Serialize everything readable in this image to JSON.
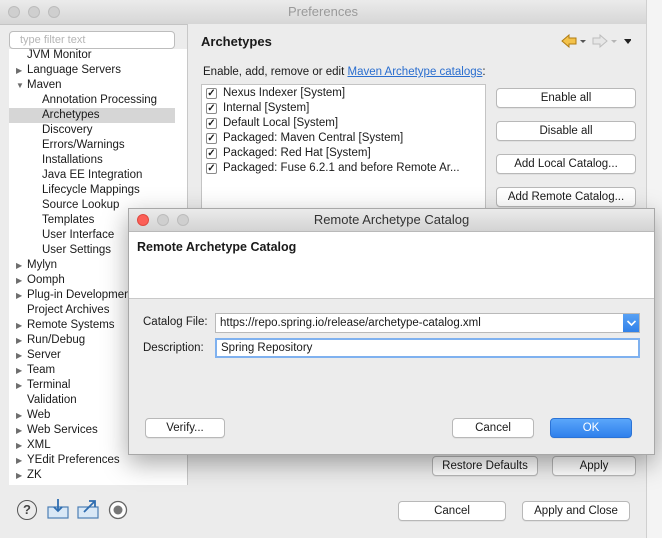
{
  "window": {
    "title": "Preferences"
  },
  "filter": {
    "placeholder": "type filter text"
  },
  "tree": [
    {
      "label": "JVM Monitor",
      "arrow": "",
      "indent": 1,
      "selected": false
    },
    {
      "label": "Language Servers",
      "arrow": "▶",
      "indent": 0,
      "selected": false
    },
    {
      "label": "Maven",
      "arrow": "▼",
      "indent": 0,
      "selected": false
    },
    {
      "label": "Annotation Processing",
      "arrow": "",
      "indent": 2,
      "selected": false
    },
    {
      "label": "Archetypes",
      "arrow": "",
      "indent": 2,
      "selected": true
    },
    {
      "label": "Discovery",
      "arrow": "",
      "indent": 2,
      "selected": false
    },
    {
      "label": "Errors/Warnings",
      "arrow": "",
      "indent": 2,
      "selected": false
    },
    {
      "label": "Installations",
      "arrow": "",
      "indent": 2,
      "selected": false
    },
    {
      "label": "Java EE Integration",
      "arrow": "",
      "indent": 2,
      "selected": false
    },
    {
      "label": "Lifecycle Mappings",
      "arrow": "",
      "indent": 2,
      "selected": false
    },
    {
      "label": "Source Lookup",
      "arrow": "",
      "indent": 2,
      "selected": false
    },
    {
      "label": "Templates",
      "arrow": "",
      "indent": 2,
      "selected": false
    },
    {
      "label": "User Interface",
      "arrow": "",
      "indent": 2,
      "selected": false
    },
    {
      "label": "User Settings",
      "arrow": "",
      "indent": 2,
      "selected": false
    },
    {
      "label": "Mylyn",
      "arrow": "▶",
      "indent": 0,
      "selected": false
    },
    {
      "label": "Oomph",
      "arrow": "▶",
      "indent": 0,
      "selected": false
    },
    {
      "label": "Plug-in Development",
      "arrow": "▶",
      "indent": 0,
      "selected": false
    },
    {
      "label": "Project Archives",
      "arrow": "",
      "indent": 1,
      "selected": false
    },
    {
      "label": "Remote Systems",
      "arrow": "▶",
      "indent": 0,
      "selected": false
    },
    {
      "label": "Run/Debug",
      "arrow": "▶",
      "indent": 0,
      "selected": false
    },
    {
      "label": "Server",
      "arrow": "▶",
      "indent": 0,
      "selected": false
    },
    {
      "label": "Team",
      "arrow": "▶",
      "indent": 0,
      "selected": false
    },
    {
      "label": "Terminal",
      "arrow": "▶",
      "indent": 0,
      "selected": false
    },
    {
      "label": "Validation",
      "arrow": "",
      "indent": 1,
      "selected": false
    },
    {
      "label": "Web",
      "arrow": "▶",
      "indent": 0,
      "selected": false
    },
    {
      "label": "Web Services",
      "arrow": "▶",
      "indent": 0,
      "selected": false
    },
    {
      "label": "XML",
      "arrow": "▶",
      "indent": 0,
      "selected": false
    },
    {
      "label": "YEdit Preferences",
      "arrow": "▶",
      "indent": 0,
      "selected": false
    },
    {
      "label": "ZK",
      "arrow": "▶",
      "indent": 0,
      "selected": false
    }
  ],
  "page": {
    "title": "Archetypes",
    "desc_prefix": "Enable, add, remove or edit ",
    "desc_link": "Maven Archetype catalogs",
    "desc_suffix": ":",
    "catalogs": [
      {
        "label": "Nexus Indexer [System]",
        "checked": true
      },
      {
        "label": "Internal [System]",
        "checked": true
      },
      {
        "label": "Default Local [System]",
        "checked": true
      },
      {
        "label": "Packaged: Maven Central [System]",
        "checked": true
      },
      {
        "label": "Packaged: Red Hat [System]",
        "checked": true
      },
      {
        "label": "Packaged: Fuse 6.2.1 and before Remote Ar...",
        "checked": true
      }
    ],
    "buttons": {
      "enable_all": "Enable all",
      "disable_all": "Disable all",
      "add_local": "Add Local Catalog...",
      "add_remote": "Add Remote Catalog..."
    },
    "restore_defaults": "Restore Defaults",
    "apply": "Apply"
  },
  "dialog": {
    "title": "Remote Archetype Catalog",
    "heading": "Remote Archetype Catalog",
    "catalog_file_label": "Catalog File:",
    "catalog_file_value": "https://repo.spring.io/release/archetype-catalog.xml",
    "description_label": "Description:",
    "description_value": "Spring Repository",
    "verify": "Verify...",
    "cancel": "Cancel",
    "ok": "OK"
  },
  "footer": {
    "cancel": "Cancel",
    "apply_close": "Apply and Close"
  },
  "colors": {
    "accent": "#3a8af0",
    "link": "#2a6ecf",
    "selection": "#d6d6d6",
    "close_red": "#fc5f57",
    "minimize_yellow": "#fdbd2e",
    "zoom_green": "#28c840"
  },
  "icons": [
    "back-arrow-icon",
    "forward-arrow-icon",
    "view-menu-icon",
    "help-icon",
    "import-icon",
    "export-icon",
    "oomph-icon",
    "dropdown-arrow-icon"
  ]
}
